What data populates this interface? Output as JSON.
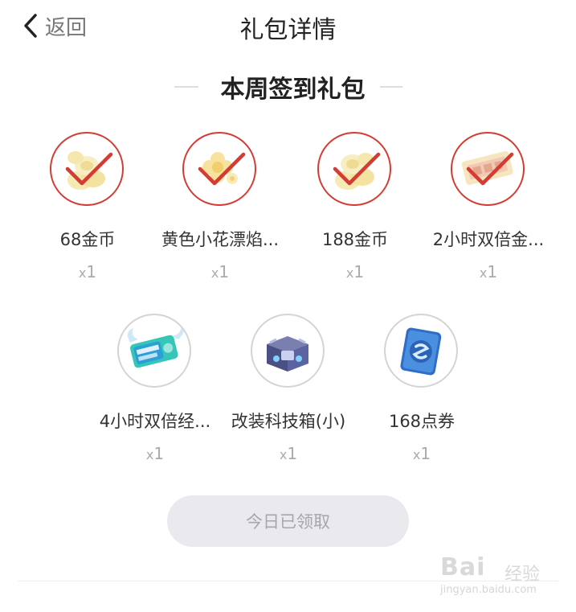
{
  "nav": {
    "back_label": "返回",
    "title": "礼包详情"
  },
  "section_title": "本周签到礼包",
  "items": [
    {
      "name": "68金币",
      "qty_prefix": "x",
      "qty": "1",
      "icon": "coins-icon",
      "checked": true
    },
    {
      "name": "黄色小花漂焰...",
      "qty_prefix": "x",
      "qty": "1",
      "icon": "yellow-flower-icon",
      "checked": true
    },
    {
      "name": "188金币",
      "qty_prefix": "x",
      "qty": "1",
      "icon": "coins-icon",
      "checked": true
    },
    {
      "name": "2小时双倍金...",
      "qty_prefix": "x",
      "qty": "1",
      "icon": "double-gold-card-icon",
      "checked": true
    },
    {
      "name": "4小时双倍经...",
      "qty_prefix": "x",
      "qty": "1",
      "icon": "double-exp-card-icon",
      "checked": false
    },
    {
      "name": "改装科技箱(小)",
      "qty_prefix": "x",
      "qty": "1",
      "icon": "tech-box-icon",
      "checked": false
    },
    {
      "name": "168点券",
      "qty_prefix": "x",
      "qty": "1",
      "icon": "coupon-icon",
      "checked": false
    }
  ],
  "claim_button": "今日已领取",
  "watermark": {
    "logo": "Bai",
    "sub": "经验",
    "url": "jingyan.baidu.com"
  },
  "colors": {
    "check": "#d33c33",
    "button_bg": "#e9e9ee",
    "button_text": "#a6a6ab"
  }
}
